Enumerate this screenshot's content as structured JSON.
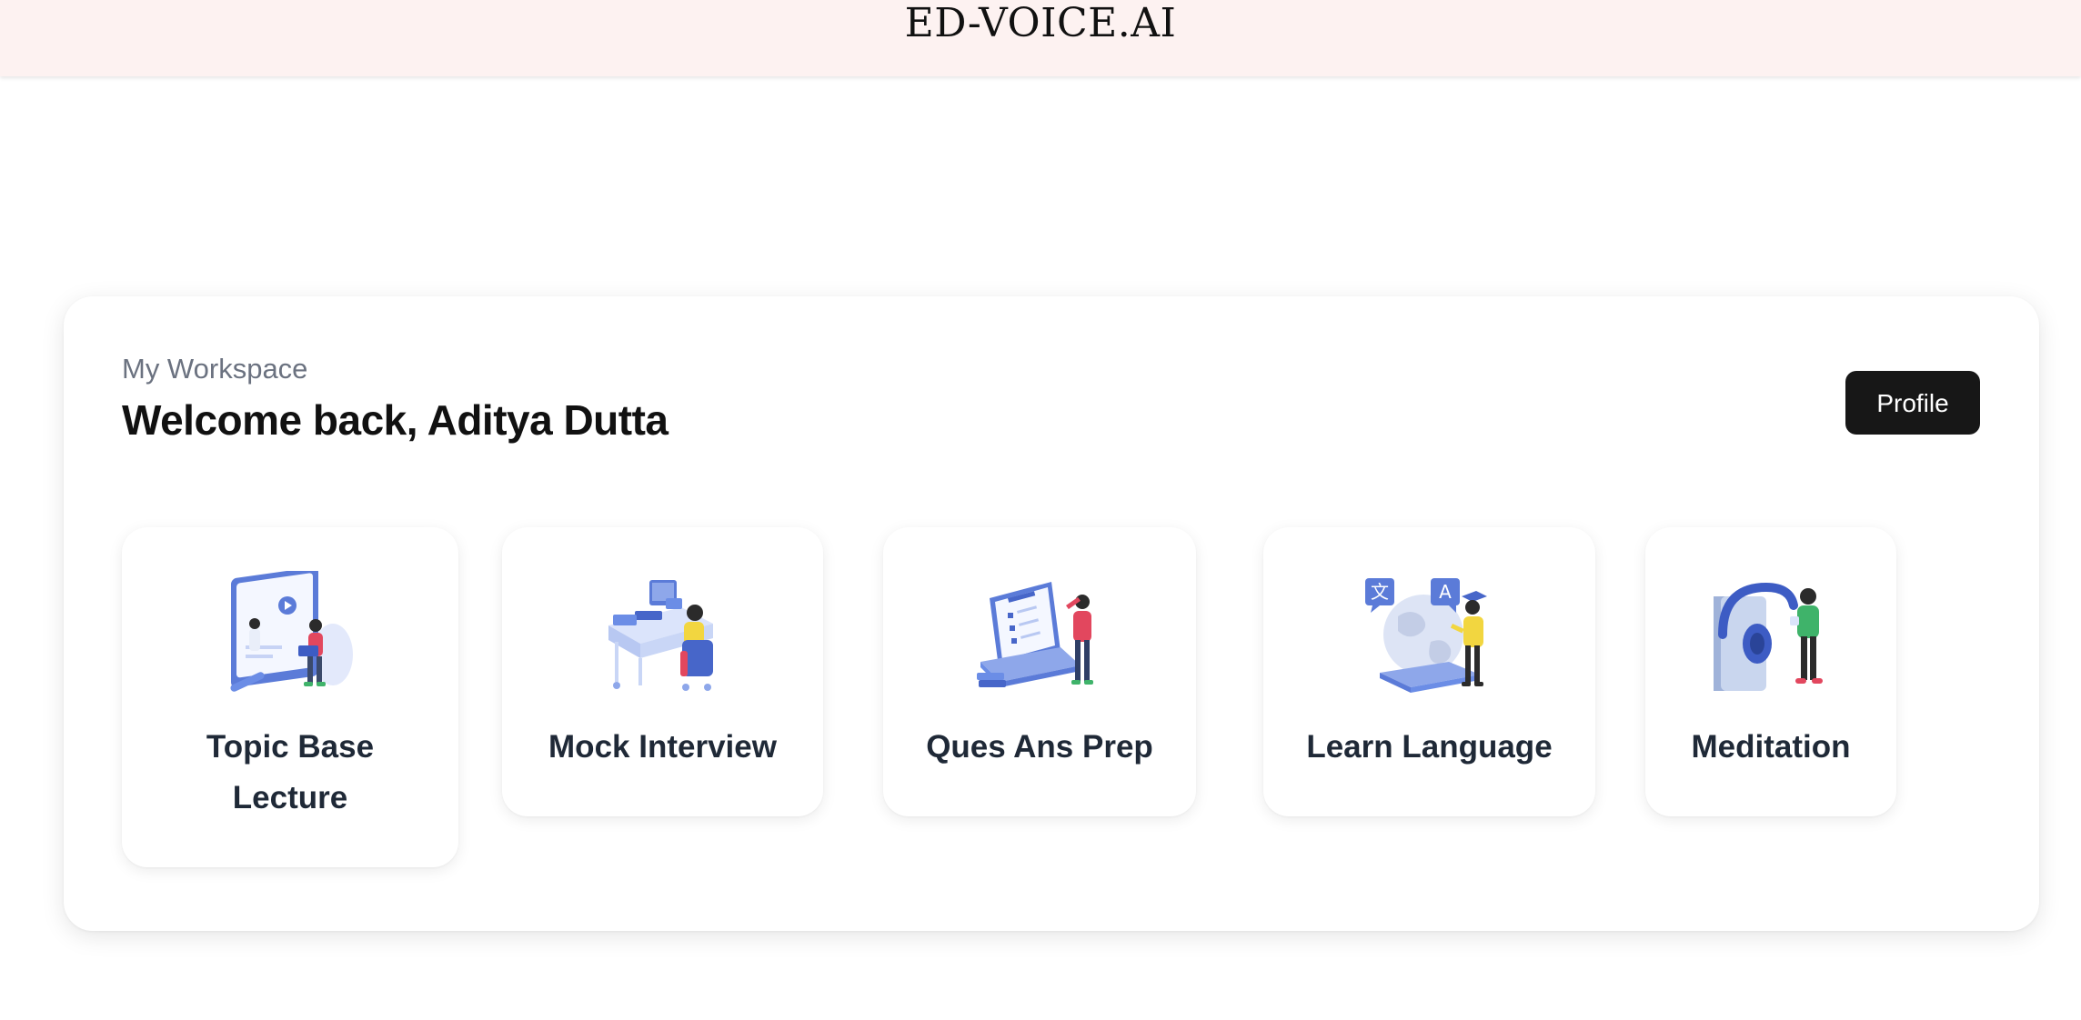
{
  "header": {
    "brand": "ED-VOICE.AI"
  },
  "workspace": {
    "eyebrow": "My Workspace",
    "welcome": "Welcome back, Aditya Dutta",
    "profile_label": "Profile"
  },
  "cards": [
    {
      "label": "Topic Base Lecture",
      "icon": "lecture-illustration"
    },
    {
      "label": "Mock Interview",
      "icon": "interview-illustration"
    },
    {
      "label": "Ques Ans Prep",
      "icon": "quiz-illustration"
    },
    {
      "label": "Learn Language",
      "icon": "language-illustration"
    },
    {
      "label": "Meditation",
      "icon": "meditation-illustration"
    }
  ],
  "colors": {
    "header_bg": "#fdf2f1",
    "button_bg": "#171717",
    "illustration_blue": "#6b8de6",
    "illustration_light": "#dbe4fb"
  }
}
